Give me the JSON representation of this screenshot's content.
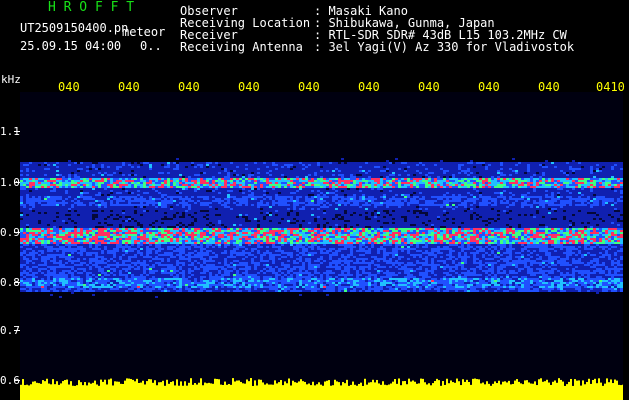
{
  "header": {
    "title": "H R O F F T",
    "filename": "UT2509150400.pn",
    "mode": "meteor",
    "datetime": "25.09.15 04:00",
    "count": "0..",
    "fields": [
      {
        "label": "Observer",
        "value": ": Masaki Kano"
      },
      {
        "label": "Receiving Location",
        "value": ": Shibukawa, Gunma, Japan"
      },
      {
        "label": "Receiver",
        "value": ": RTL-SDR SDR# 43dB L15 103.2MHz CW"
      },
      {
        "label": "Receiving Antenna",
        "value": ": 3el Yagi(V) Az 330 for Vladivostok"
      }
    ]
  },
  "axis": {
    "unit": "kHz",
    "y_ticks": [
      "1.1",
      "1.0",
      "0.9",
      "0.8",
      "0.7",
      "0.6"
    ],
    "x_ticks": [
      "040",
      "040",
      "040",
      "040",
      "040",
      "040",
      "040",
      "040",
      "040",
      "0410"
    ]
  },
  "colors": {
    "background": "#000000",
    "header_text": "#ffffff",
    "title_text": "#18e018",
    "time_ticks": "#ffff00",
    "noise_floor": "#ffff00"
  }
}
